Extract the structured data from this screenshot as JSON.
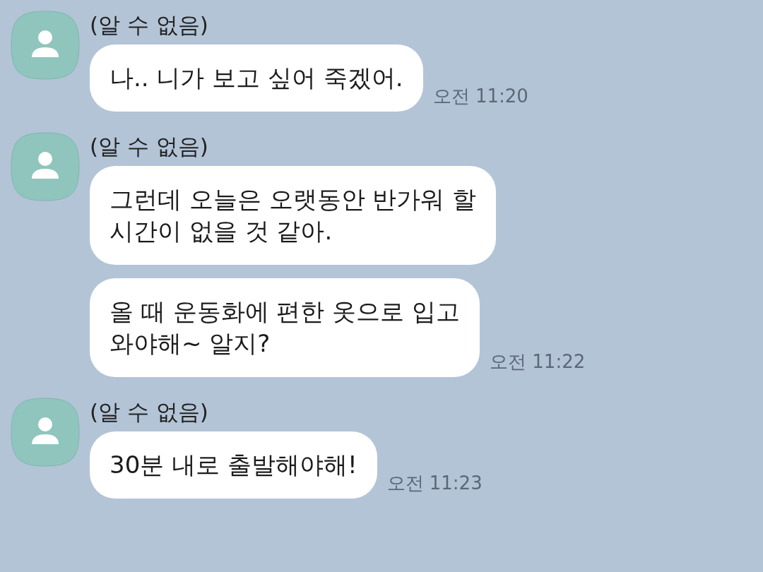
{
  "messages": [
    {
      "sender": "(알 수 없음)",
      "bubbles": [
        {
          "text": "나.. 니가 보고 싶어 죽겠어.",
          "time": "오전 11:20"
        }
      ]
    },
    {
      "sender": "(알 수 없음)",
      "bubbles": [
        {
          "text": "그런데 오늘은 오랫동안 반가워 할\n시간이 없을 것 같아."
        },
        {
          "text": "올 때 운동화에 편한 옷으로 입고\n와야해~ 알지?",
          "time": "오전 11:22"
        }
      ]
    },
    {
      "sender": "(알 수 없음)",
      "bubbles": [
        {
          "text": "30분 내로 출발해야해!",
          "time": "오전 11:23"
        }
      ]
    }
  ]
}
